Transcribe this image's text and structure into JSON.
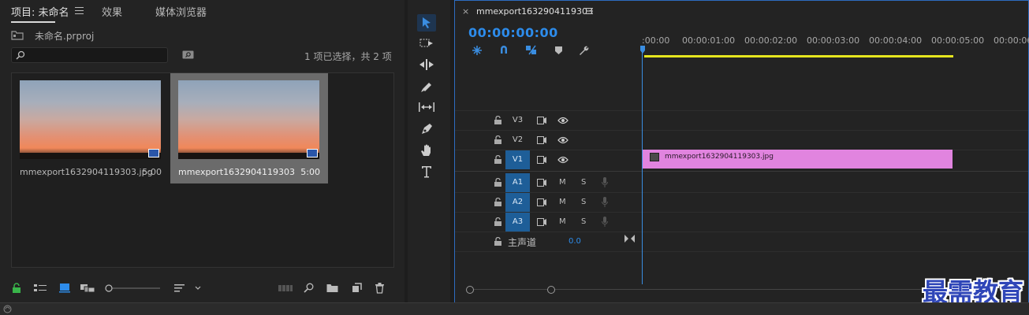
{
  "project_panel": {
    "tabs": [
      {
        "label": "项目: 未命名"
      },
      {
        "label": "效果"
      },
      {
        "label": "媒体浏览器"
      }
    ],
    "project_file": "未命名.prproj",
    "selection_status": "1 项已选择，共 2 项",
    "items": [
      {
        "name": "mmexport1632904119303.jpg",
        "duration": "5:00",
        "selected": false
      },
      {
        "name": "mmexport1632904119303",
        "duration": "5:00",
        "selected": true
      }
    ],
    "footer_icons": [
      "lock-icon",
      "list-view-icon",
      "icon-view-icon",
      "freeform-view-icon",
      "zoom-slider",
      "sort-icon",
      "automate-icon",
      "find-icon",
      "new-bin-icon",
      "new-item-icon",
      "clear-icon"
    ]
  },
  "tools": [
    "selection-tool",
    "track-select-tool",
    "ripple-edit-tool",
    "razor-tool",
    "slip-tool",
    "pen-tool",
    "hand-tool",
    "type-tool"
  ],
  "timeline": {
    "sequence_name": "mmexport1632904119303",
    "close_label": "×",
    "timecode": "00:00:00:00",
    "ruler_labels": [
      ":00:00",
      "00:00:01:00",
      "00:00:02:00",
      "00:00:03:00",
      "00:00:04:00",
      "00:00:05:00",
      "00:00:06"
    ],
    "video_tracks": [
      {
        "name": "V3",
        "targeted": false
      },
      {
        "name": "V2",
        "targeted": false
      },
      {
        "name": "V1",
        "targeted": true
      }
    ],
    "audio_tracks": [
      {
        "name": "A1",
        "mute": "M",
        "solo": "S"
      },
      {
        "name": "A2",
        "mute": "M",
        "solo": "S"
      },
      {
        "name": "A3",
        "mute": "M",
        "solo": "S"
      }
    ],
    "master": {
      "label": "主声道",
      "value": "0.0"
    },
    "clip": {
      "name": "mmexport1632904119303.jpg",
      "track": "V1",
      "color": "#e184df"
    }
  },
  "watermark": "最需教育",
  "colors": {
    "accent": "#2d8ceb",
    "clip": "#e184df",
    "work_area": "#e6e61e",
    "track_target": "#1e5e98"
  }
}
